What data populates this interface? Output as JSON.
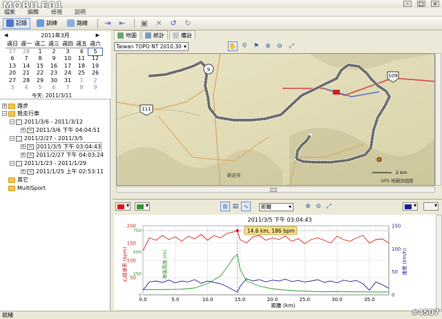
{
  "brand": "MOBILE01",
  "menu": [
    "檔案",
    "編輯",
    "檢視",
    "說明"
  ],
  "toolbar": {
    "tabs": [
      "記錄",
      "訓練",
      "路線"
    ]
  },
  "calendar": {
    "title": "2011年3月",
    "days_of_week": [
      "週日",
      "週一",
      "週二",
      "週三",
      "週四",
      "週五",
      "週六"
    ],
    "weeks": [
      [
        "27",
        "28",
        "1",
        "2",
        "3",
        "4",
        "5"
      ],
      [
        "6",
        "7",
        "8",
        "9",
        "10",
        "11",
        "12"
      ],
      [
        "13",
        "14",
        "15",
        "16",
        "17",
        "18",
        "19"
      ],
      [
        "20",
        "21",
        "22",
        "23",
        "24",
        "25",
        "26"
      ],
      [
        "27",
        "28",
        "29",
        "30",
        "31",
        "1",
        "2"
      ],
      [
        "3",
        "4",
        "5",
        "6",
        "7",
        "8",
        "9"
      ]
    ],
    "today_label": "今天: 2011/3/11"
  },
  "tree": {
    "root1": "路步",
    "root2": "競走行車",
    "items": [
      {
        "label": "2011/3/6 - 2011/3/12",
        "type": "week"
      },
      {
        "label": "2011/3/6 下午 04:04:51",
        "type": "activity"
      },
      {
        "label": "2011/2/27 - 2011/3/5",
        "type": "week"
      },
      {
        "label": "2011/3/5 下午 03:04:43",
        "type": "activity",
        "selected": true
      },
      {
        "label": "2011/2/27 下午 04:03:24",
        "type": "activity"
      },
      {
        "label": "2011/1/23 - 2011/1/29",
        "type": "week"
      },
      {
        "label": "2011/1/25 上午 02:53:11",
        "type": "activity"
      }
    ],
    "root3": "其它",
    "root4": "MultiSport"
  },
  "map": {
    "tabs": [
      "地圖",
      "統計",
      "備註"
    ],
    "map_select": "Taiwan TOPO NT 2010.30",
    "labels": {
      "road_9": "9",
      "road_111": "111",
      "road_109": "109",
      "town": "新店市",
      "scale": "2 km",
      "source": "GPS 地圖詳細度"
    }
  },
  "chart_toolbar": {
    "x_axis_select": "距離"
  },
  "chart_data": {
    "type": "line",
    "title": "2011/3/5 下午 03:04:43",
    "xlabel": "距離 (km)",
    "x_ticks": [
      "0.0",
      "5.0",
      "10.0",
      "15.0",
      "20.0",
      "25.0",
      "30.0",
      "35.0"
    ],
    "xlim": [
      0,
      38
    ],
    "y_left_label": "心跳速率 (bpm)",
    "y_left_ticks": [
      "50",
      "100",
      "150",
      "200"
    ],
    "y_left_lim": [
      0,
      200
    ],
    "y_left2_label": "海拔高度 (m)",
    "y_left2_ticks": [
      "0",
      "250",
      "500",
      "750"
    ],
    "y_left2_lim": [
      0,
      800
    ],
    "y_right_label": "速度 (km/h)",
    "y_right_ticks": [
      "0",
      "50",
      "100",
      "150"
    ],
    "y_right_lim": [
      0,
      150
    ],
    "annotation": "14.6 km, 186 bpm",
    "annotation_x": 14.6,
    "annotation_y": 186,
    "series": [
      {
        "color": "#d81818",
        "x": [
          0,
          1,
          2,
          3,
          4,
          5,
          6,
          7,
          8,
          9,
          10,
          11,
          12,
          13,
          14,
          14.6,
          15,
          16,
          17,
          18,
          19,
          20,
          21,
          22,
          23,
          24,
          25,
          26,
          27,
          28,
          29,
          30,
          31,
          32,
          33,
          34,
          35,
          36,
          37,
          38
        ],
        "values": [
          128,
          165,
          158,
          172,
          160,
          168,
          155,
          170,
          162,
          175,
          158,
          172,
          165,
          178,
          182,
          186,
          160,
          150,
          168,
          172,
          158,
          165,
          160,
          170,
          155,
          163,
          148,
          160,
          165,
          158,
          150,
          170,
          160,
          155,
          165,
          172,
          150,
          160,
          162,
          150
        ]
      },
      {
        "color": "#2a9a2a",
        "x": [
          0,
          2,
          4,
          6,
          8,
          10,
          12,
          13,
          14,
          14.6,
          15,
          16,
          18,
          20,
          22,
          24,
          26,
          28,
          30,
          32,
          34,
          36,
          38
        ],
        "values": [
          60,
          60,
          62,
          65,
          80,
          130,
          220,
          320,
          430,
          470,
          300,
          160,
          100,
          70,
          55,
          45,
          40,
          35,
          38,
          35,
          34,
          33,
          33
        ]
      },
      {
        "color": "#1a1a9a",
        "x": [
          0,
          1,
          2,
          3,
          4,
          5,
          6,
          7,
          8,
          9,
          10,
          11,
          12,
          13,
          14,
          14.6,
          15,
          16,
          17,
          18,
          19,
          20,
          21,
          22,
          23,
          24,
          25,
          26,
          27,
          28,
          29,
          30,
          31,
          32,
          33,
          34,
          35,
          36,
          37,
          38
        ],
        "values": [
          10,
          28,
          30,
          27,
          32,
          26,
          30,
          28,
          33,
          25,
          30,
          27,
          24,
          18,
          10,
          6,
          18,
          35,
          30,
          33,
          28,
          32,
          30,
          34,
          29,
          31,
          28,
          30,
          33,
          27,
          30,
          26,
          32,
          29,
          31,
          24,
          10,
          28,
          22,
          14
        ]
      }
    ]
  },
  "status": "就緒",
  "watermark": "#4507"
}
